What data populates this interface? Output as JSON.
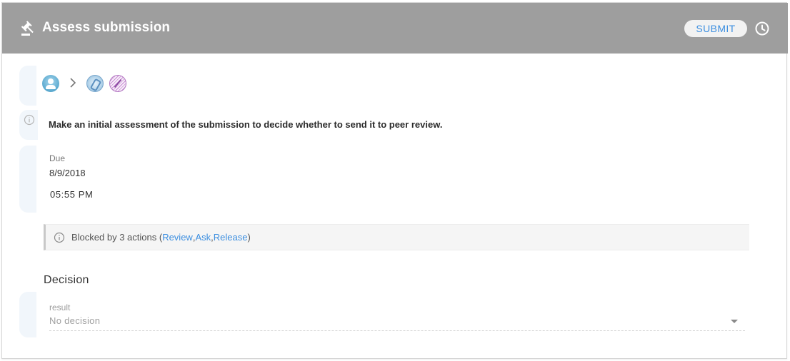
{
  "header": {
    "title": "Assess submission",
    "submit_label": "SUBMIT",
    "icons": {
      "title_icon": "gavel-icon",
      "history": "clock-history-icon"
    },
    "background": "#9e9e9e"
  },
  "participants": {
    "icons": [
      "user-avatar-icon",
      "chevron-right-icon",
      "editor-avatar-icon",
      "reviewer-avatar-icon"
    ]
  },
  "instruction": {
    "text": "Make an initial assessment of the submission to decide whether to send it to peer review."
  },
  "due": {
    "label": "Due",
    "date": "8/9/2018",
    "time": "05:55 PM"
  },
  "blocked": {
    "prefix": "Blocked by 3 actions (",
    "actions": [
      "Review",
      "Ask",
      "Release"
    ],
    "sep": ", ",
    "suffix": ")"
  },
  "decision": {
    "title": "Decision",
    "field_label": "result",
    "value": "No decision"
  },
  "colors": {
    "accent": "#3d8fe0",
    "rail": "#f1f6fb"
  }
}
